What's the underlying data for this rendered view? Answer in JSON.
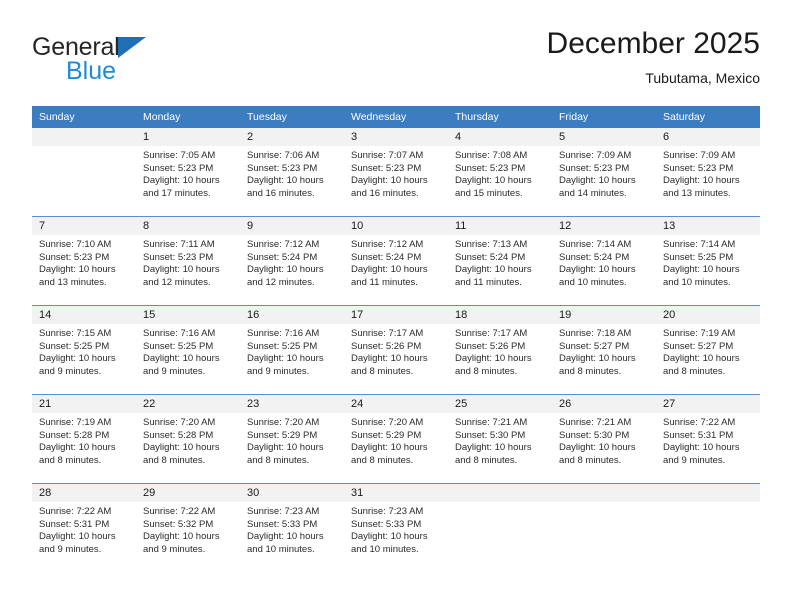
{
  "brand": {
    "name_top": "General",
    "name_bottom": "Blue",
    "triangle_color": "#1f6fb5",
    "blue_text_color": "#1f8ad6"
  },
  "header": {
    "title": "December 2025",
    "subtitle": "Tubutama, Mexico"
  },
  "theme": {
    "header_bg": "#3b7dc0",
    "header_text": "#ffffff",
    "daynum_band_bg": "#f2f2f2",
    "week_divider": "#5a8fcb",
    "page_bg": "#ffffff"
  },
  "calendar": {
    "weekday_headers": [
      "Sunday",
      "Monday",
      "Tuesday",
      "Wednesday",
      "Thursday",
      "Friday",
      "Saturday"
    ],
    "weeks": [
      [
        {
          "day": "",
          "blank": true,
          "sunrise": "",
          "sunset": "",
          "daylight1": "",
          "daylight2": ""
        },
        {
          "day": "1",
          "blank": false,
          "sunrise": "Sunrise: 7:05 AM",
          "sunset": "Sunset: 5:23 PM",
          "daylight1": "Daylight: 10 hours",
          "daylight2": "and 17 minutes."
        },
        {
          "day": "2",
          "blank": false,
          "sunrise": "Sunrise: 7:06 AM",
          "sunset": "Sunset: 5:23 PM",
          "daylight1": "Daylight: 10 hours",
          "daylight2": "and 16 minutes."
        },
        {
          "day": "3",
          "blank": false,
          "sunrise": "Sunrise: 7:07 AM",
          "sunset": "Sunset: 5:23 PM",
          "daylight1": "Daylight: 10 hours",
          "daylight2": "and 16 minutes."
        },
        {
          "day": "4",
          "blank": false,
          "sunrise": "Sunrise: 7:08 AM",
          "sunset": "Sunset: 5:23 PM",
          "daylight1": "Daylight: 10 hours",
          "daylight2": "and 15 minutes."
        },
        {
          "day": "5",
          "blank": false,
          "sunrise": "Sunrise: 7:09 AM",
          "sunset": "Sunset: 5:23 PM",
          "daylight1": "Daylight: 10 hours",
          "daylight2": "and 14 minutes."
        },
        {
          "day": "6",
          "blank": false,
          "sunrise": "Sunrise: 7:09 AM",
          "sunset": "Sunset: 5:23 PM",
          "daylight1": "Daylight: 10 hours",
          "daylight2": "and 13 minutes."
        }
      ],
      [
        {
          "day": "7",
          "blank": false,
          "sunrise": "Sunrise: 7:10 AM",
          "sunset": "Sunset: 5:23 PM",
          "daylight1": "Daylight: 10 hours",
          "daylight2": "and 13 minutes."
        },
        {
          "day": "8",
          "blank": false,
          "sunrise": "Sunrise: 7:11 AM",
          "sunset": "Sunset: 5:23 PM",
          "daylight1": "Daylight: 10 hours",
          "daylight2": "and 12 minutes."
        },
        {
          "day": "9",
          "blank": false,
          "sunrise": "Sunrise: 7:12 AM",
          "sunset": "Sunset: 5:24 PM",
          "daylight1": "Daylight: 10 hours",
          "daylight2": "and 12 minutes."
        },
        {
          "day": "10",
          "blank": false,
          "sunrise": "Sunrise: 7:12 AM",
          "sunset": "Sunset: 5:24 PM",
          "daylight1": "Daylight: 10 hours",
          "daylight2": "and 11 minutes."
        },
        {
          "day": "11",
          "blank": false,
          "sunrise": "Sunrise: 7:13 AM",
          "sunset": "Sunset: 5:24 PM",
          "daylight1": "Daylight: 10 hours",
          "daylight2": "and 11 minutes."
        },
        {
          "day": "12",
          "blank": false,
          "sunrise": "Sunrise: 7:14 AM",
          "sunset": "Sunset: 5:24 PM",
          "daylight1": "Daylight: 10 hours",
          "daylight2": "and 10 minutes."
        },
        {
          "day": "13",
          "blank": false,
          "sunrise": "Sunrise: 7:14 AM",
          "sunset": "Sunset: 5:25 PM",
          "daylight1": "Daylight: 10 hours",
          "daylight2": "and 10 minutes."
        }
      ],
      [
        {
          "day": "14",
          "blank": false,
          "sunrise": "Sunrise: 7:15 AM",
          "sunset": "Sunset: 5:25 PM",
          "daylight1": "Daylight: 10 hours",
          "daylight2": "and 9 minutes."
        },
        {
          "day": "15",
          "blank": false,
          "sunrise": "Sunrise: 7:16 AM",
          "sunset": "Sunset: 5:25 PM",
          "daylight1": "Daylight: 10 hours",
          "daylight2": "and 9 minutes."
        },
        {
          "day": "16",
          "blank": false,
          "sunrise": "Sunrise: 7:16 AM",
          "sunset": "Sunset: 5:25 PM",
          "daylight1": "Daylight: 10 hours",
          "daylight2": "and 9 minutes."
        },
        {
          "day": "17",
          "blank": false,
          "sunrise": "Sunrise: 7:17 AM",
          "sunset": "Sunset: 5:26 PM",
          "daylight1": "Daylight: 10 hours",
          "daylight2": "and 8 minutes."
        },
        {
          "day": "18",
          "blank": false,
          "sunrise": "Sunrise: 7:17 AM",
          "sunset": "Sunset: 5:26 PM",
          "daylight1": "Daylight: 10 hours",
          "daylight2": "and 8 minutes."
        },
        {
          "day": "19",
          "blank": false,
          "sunrise": "Sunrise: 7:18 AM",
          "sunset": "Sunset: 5:27 PM",
          "daylight1": "Daylight: 10 hours",
          "daylight2": "and 8 minutes."
        },
        {
          "day": "20",
          "blank": false,
          "sunrise": "Sunrise: 7:19 AM",
          "sunset": "Sunset: 5:27 PM",
          "daylight1": "Daylight: 10 hours",
          "daylight2": "and 8 minutes."
        }
      ],
      [
        {
          "day": "21",
          "blank": false,
          "sunrise": "Sunrise: 7:19 AM",
          "sunset": "Sunset: 5:28 PM",
          "daylight1": "Daylight: 10 hours",
          "daylight2": "and 8 minutes."
        },
        {
          "day": "22",
          "blank": false,
          "sunrise": "Sunrise: 7:20 AM",
          "sunset": "Sunset: 5:28 PM",
          "daylight1": "Daylight: 10 hours",
          "daylight2": "and 8 minutes."
        },
        {
          "day": "23",
          "blank": false,
          "sunrise": "Sunrise: 7:20 AM",
          "sunset": "Sunset: 5:29 PM",
          "daylight1": "Daylight: 10 hours",
          "daylight2": "and 8 minutes."
        },
        {
          "day": "24",
          "blank": false,
          "sunrise": "Sunrise: 7:20 AM",
          "sunset": "Sunset: 5:29 PM",
          "daylight1": "Daylight: 10 hours",
          "daylight2": "and 8 minutes."
        },
        {
          "day": "25",
          "blank": false,
          "sunrise": "Sunrise: 7:21 AM",
          "sunset": "Sunset: 5:30 PM",
          "daylight1": "Daylight: 10 hours",
          "daylight2": "and 8 minutes."
        },
        {
          "day": "26",
          "blank": false,
          "sunrise": "Sunrise: 7:21 AM",
          "sunset": "Sunset: 5:30 PM",
          "daylight1": "Daylight: 10 hours",
          "daylight2": "and 8 minutes."
        },
        {
          "day": "27",
          "blank": false,
          "sunrise": "Sunrise: 7:22 AM",
          "sunset": "Sunset: 5:31 PM",
          "daylight1": "Daylight: 10 hours",
          "daylight2": "and 9 minutes."
        }
      ],
      [
        {
          "day": "28",
          "blank": false,
          "sunrise": "Sunrise: 7:22 AM",
          "sunset": "Sunset: 5:31 PM",
          "daylight1": "Daylight: 10 hours",
          "daylight2": "and 9 minutes."
        },
        {
          "day": "29",
          "blank": false,
          "sunrise": "Sunrise: 7:22 AM",
          "sunset": "Sunset: 5:32 PM",
          "daylight1": "Daylight: 10 hours",
          "daylight2": "and 9 minutes."
        },
        {
          "day": "30",
          "blank": false,
          "sunrise": "Sunrise: 7:23 AM",
          "sunset": "Sunset: 5:33 PM",
          "daylight1": "Daylight: 10 hours",
          "daylight2": "and 10 minutes."
        },
        {
          "day": "31",
          "blank": false,
          "sunrise": "Sunrise: 7:23 AM",
          "sunset": "Sunset: 5:33 PM",
          "daylight1": "Daylight: 10 hours",
          "daylight2": "and 10 minutes."
        },
        {
          "day": "",
          "blank": true,
          "sunrise": "",
          "sunset": "",
          "daylight1": "",
          "daylight2": ""
        },
        {
          "day": "",
          "blank": true,
          "sunrise": "",
          "sunset": "",
          "daylight1": "",
          "daylight2": ""
        },
        {
          "day": "",
          "blank": true,
          "sunrise": "",
          "sunset": "",
          "daylight1": "",
          "daylight2": ""
        }
      ]
    ]
  }
}
